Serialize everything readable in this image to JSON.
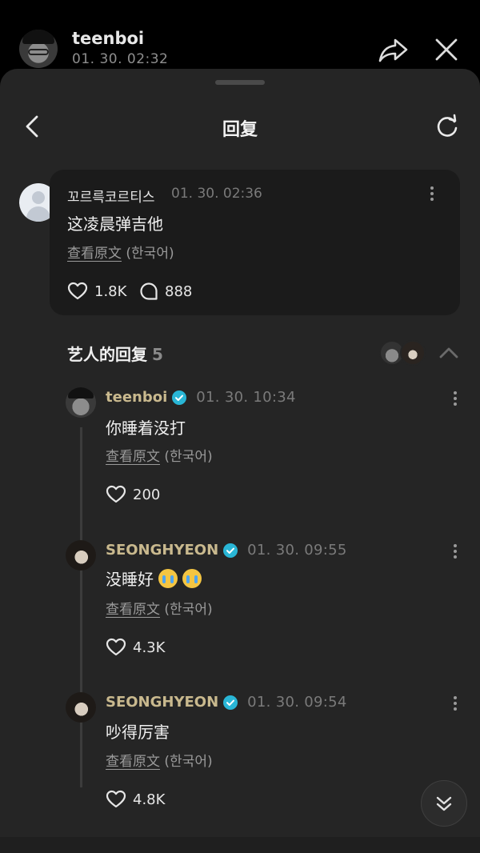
{
  "top": {
    "username": "teenboi",
    "timestamp": "01. 30. 02:32",
    "share_icon": "share-arrow-icon",
    "close_icon": "close-icon"
  },
  "sheet": {
    "title": "回复",
    "back_icon": "chevron-left-icon",
    "refresh_icon": "refresh-icon"
  },
  "comment": {
    "author": "꼬르륵코르티스",
    "timestamp": "01. 30. 02:36",
    "text": "这凌晨弹吉他",
    "view_original": "查看原文",
    "original_lang": "(한국어)",
    "likes": "1.8K",
    "replies": "888"
  },
  "artist_replies": {
    "label": "艺人的回复",
    "count": "5",
    "items": [
      {
        "author": "teenboi",
        "timestamp": "01. 30. 10:34",
        "text": "你睡着没打",
        "view_original": "查看原文",
        "original_lang": "(한국어)",
        "likes": "200"
      },
      {
        "author": "SEONGHYEON",
        "timestamp": "01. 30. 09:55",
        "text": "没睡好",
        "view_original": "查看原文",
        "original_lang": "(한국어)",
        "likes": "4.3K"
      },
      {
        "author": "SEONGHYEON",
        "timestamp": "01. 30. 09:54",
        "text": "吵得厉害",
        "view_original": "查看原文",
        "original_lang": "(한국어)",
        "likes": "4.8K"
      }
    ]
  },
  "colors": {
    "background": "#000000",
    "sheet": "#252525",
    "card": "#1b1b1b",
    "artist_name": "#c9b98e",
    "verified": "#29b6d6"
  }
}
